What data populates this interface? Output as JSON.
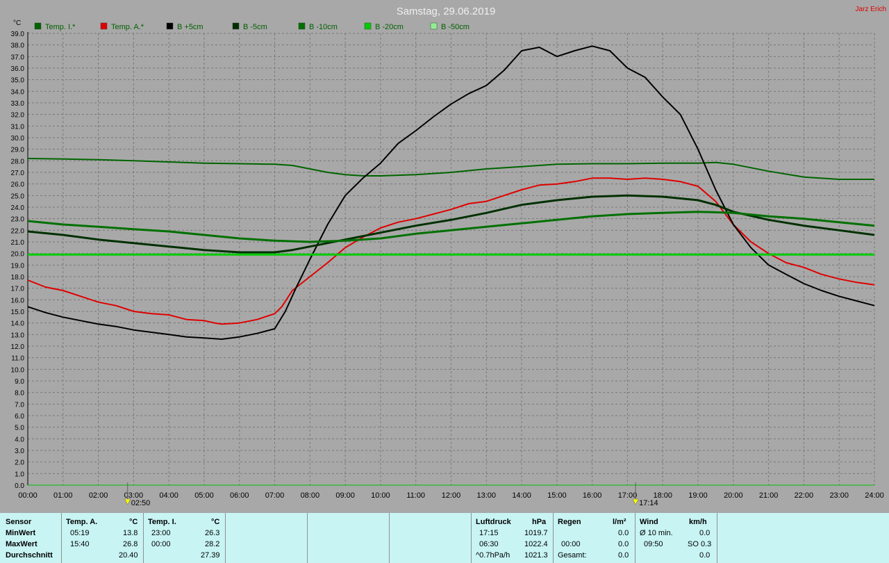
{
  "chart_data": {
    "type": "line",
    "title": "Samstag, 29.06.2019",
    "author": "Jarz Erich",
    "ylabel": "°C",
    "ylim": [
      0,
      39
    ],
    "xlim": [
      0,
      24
    ],
    "grid": true,
    "x_ticks": [
      "00:00",
      "01:00",
      "02:00",
      "03:00",
      "04:00",
      "05:00",
      "06:00",
      "07:00",
      "08:00",
      "09:00",
      "10:00",
      "11:00",
      "12:00",
      "13:00",
      "14:00",
      "15:00",
      "16:00",
      "17:00",
      "18:00",
      "19:00",
      "20:00",
      "21:00",
      "22:00",
      "23:00",
      "24:00"
    ],
    "y_ticks": [
      "0.0",
      "1.0",
      "2.0",
      "3.0",
      "4.0",
      "5.0",
      "6.0",
      "7.0",
      "8.0",
      "9.0",
      "10.0",
      "11.0",
      "12.0",
      "13.0",
      "14.0",
      "15.0",
      "16.0",
      "17.0",
      "18.0",
      "19.0",
      "20.0",
      "21.0",
      "22.0",
      "23.0",
      "24.0",
      "25.0",
      "26.0",
      "27.0",
      "28.0",
      "29.0",
      "30.0",
      "31.0",
      "32.0",
      "33.0",
      "34.0",
      "35.0",
      "36.0",
      "37.0",
      "38.0",
      "39.0"
    ],
    "sunrise": "02:50",
    "sunset": "17:14",
    "sunrise_x": 2.83,
    "sunset_x": 17.23,
    "series": [
      {
        "name": "Temp. I.*",
        "color": "#006400",
        "width": 2,
        "x": [
          0,
          1,
          2,
          3,
          4,
          5,
          6,
          7,
          7.5,
          8,
          8.5,
          9,
          9.5,
          10,
          11,
          12,
          13,
          14,
          15,
          16,
          17,
          18,
          19,
          19.5,
          20,
          20.5,
          21,
          22,
          23,
          24
        ],
        "values": [
          28.2,
          28.15,
          28.1,
          28.0,
          27.9,
          27.8,
          27.75,
          27.7,
          27.6,
          27.3,
          27.0,
          26.8,
          26.7,
          26.7,
          26.8,
          27.0,
          27.3,
          27.5,
          27.7,
          27.75,
          27.75,
          27.8,
          27.8,
          27.85,
          27.7,
          27.4,
          27.1,
          26.6,
          26.4,
          26.4
        ]
      },
      {
        "name": "Temp. A.*",
        "color": "#e00000",
        "width": 2,
        "x": [
          0,
          0.5,
          1,
          1.5,
          2,
          2.5,
          3,
          3.5,
          4,
          4.5,
          5,
          5.3,
          5.5,
          6,
          6.5,
          7,
          7.2,
          7.5,
          8,
          8.5,
          9,
          9.5,
          10,
          10.5,
          11,
          11.5,
          12,
          12.5,
          13,
          13.5,
          14,
          14.5,
          15,
          15.5,
          16,
          16.5,
          17,
          17.5,
          18,
          18.5,
          19,
          19.5,
          20,
          20.5,
          21,
          21.5,
          22,
          22.5,
          23,
          23.5,
          24
        ],
        "values": [
          17.7,
          17.1,
          16.8,
          16.3,
          15.8,
          15.5,
          15.0,
          14.8,
          14.7,
          14.3,
          14.2,
          14.0,
          13.9,
          14.0,
          14.3,
          14.8,
          15.4,
          16.8,
          18.0,
          19.2,
          20.5,
          21.4,
          22.2,
          22.7,
          23.0,
          23.4,
          23.8,
          24.3,
          24.5,
          25.0,
          25.5,
          25.9,
          26.0,
          26.2,
          26.5,
          26.5,
          26.4,
          26.5,
          26.4,
          26.2,
          25.8,
          24.5,
          22.5,
          21.0,
          20.0,
          19.2,
          18.8,
          18.2,
          17.8,
          17.5,
          17.3
        ]
      },
      {
        "name": "B +5cm",
        "color": "#000000",
        "width": 2,
        "x": [
          0,
          0.5,
          1,
          1.5,
          2,
          2.5,
          3,
          3.5,
          4,
          4.5,
          5,
          5.5,
          6,
          6.5,
          7,
          7.3,
          7.6,
          8,
          8.5,
          9,
          9.5,
          10,
          10.5,
          11,
          11.5,
          12,
          12.5,
          13,
          13.5,
          14,
          14.5,
          15,
          15.5,
          16,
          16.5,
          17,
          17.5,
          18,
          18.5,
          19,
          19.5,
          20,
          20.5,
          21,
          21.5,
          22,
          22.5,
          23,
          23.5,
          24
        ],
        "values": [
          15.4,
          14.9,
          14.5,
          14.2,
          13.9,
          13.7,
          13.4,
          13.2,
          13.0,
          12.8,
          12.7,
          12.6,
          12.8,
          13.1,
          13.5,
          15.0,
          17.0,
          19.5,
          22.5,
          25.0,
          26.5,
          27.8,
          29.5,
          30.6,
          31.8,
          32.9,
          33.8,
          34.5,
          35.8,
          37.5,
          37.8,
          37.0,
          37.5,
          37.9,
          37.5,
          36.0,
          35.2,
          33.5,
          32.0,
          29.0,
          25.5,
          22.5,
          20.5,
          19.0,
          18.2,
          17.4,
          16.8,
          16.3,
          15.9,
          15.5
        ]
      },
      {
        "name": "B -5cm",
        "color": "#003000",
        "width": 3,
        "x": [
          0,
          1,
          2,
          3,
          4,
          5,
          6,
          7,
          7.5,
          8,
          8.5,
          9,
          10,
          11,
          12,
          13,
          14,
          15,
          16,
          17,
          18,
          19,
          19.5,
          20,
          21,
          22,
          23,
          24
        ],
        "values": [
          21.9,
          21.6,
          21.2,
          20.9,
          20.6,
          20.3,
          20.1,
          20.1,
          20.3,
          20.6,
          20.9,
          21.2,
          21.8,
          22.4,
          22.9,
          23.5,
          24.2,
          24.6,
          24.9,
          25.0,
          24.9,
          24.6,
          24.2,
          23.6,
          22.9,
          22.4,
          22.0,
          21.6
        ]
      },
      {
        "name": "B -10cm",
        "color": "#007000",
        "width": 3,
        "x": [
          0,
          1,
          2,
          3,
          4,
          5,
          6,
          7,
          8,
          9,
          10,
          11,
          12,
          13,
          14,
          15,
          16,
          17,
          18,
          19,
          20,
          21,
          22,
          23,
          24
        ],
        "values": [
          22.8,
          22.5,
          22.3,
          22.1,
          21.9,
          21.6,
          21.3,
          21.1,
          21.0,
          21.1,
          21.3,
          21.7,
          22.0,
          22.3,
          22.6,
          22.9,
          23.2,
          23.4,
          23.5,
          23.6,
          23.5,
          23.2,
          23.0,
          22.7,
          22.4
        ]
      },
      {
        "name": "B -20cm",
        "color": "#00cc00",
        "width": 3,
        "x": [
          0,
          24
        ],
        "values": [
          19.9,
          19.9
        ]
      },
      {
        "name": "B -50cm",
        "color": "#90ee90",
        "width": 0,
        "x": [],
        "values": []
      }
    ]
  },
  "bottom": {
    "sensor_label": "Sensor",
    "min_label": "MinWert",
    "max_label": "MaxWert",
    "avg_label": "Durchschnitt",
    "temp_a": {
      "header": "Temp. A.",
      "unit": "°C",
      "min_time": "05:19",
      "min_val": "13.8",
      "max_time": "15:40",
      "max_val": "26.8",
      "avg": "20.40"
    },
    "temp_i": {
      "header": "Temp. I.",
      "unit": "°C",
      "min_time": "23:00",
      "min_val": "26.3",
      "max_time": "00:00",
      "max_val": "28.2",
      "avg": "27.39"
    },
    "pressure": {
      "header": "Luftdruck",
      "unit": "hPa",
      "min_time": "17:15",
      "min_val": "1019.7",
      "max_time": "06:30",
      "max_val": "1022.4",
      "trend_label": "^0.7hPa/h",
      "trend_val": "1021.3"
    },
    "rain": {
      "header": "Regen",
      "unit": "l/m²",
      "min_val": "0.0",
      "max_time": "00:00",
      "max_val": "0.0",
      "total_label": "Gesamt:",
      "total_val": "0.0"
    },
    "wind": {
      "header": "Wind",
      "unit": "km/h",
      "avg_label": "Ø 10 min.",
      "avg_val": "0.0",
      "max_time": "09:50",
      "max_val": "SO 0.3",
      "row3_val": "0.0"
    }
  }
}
